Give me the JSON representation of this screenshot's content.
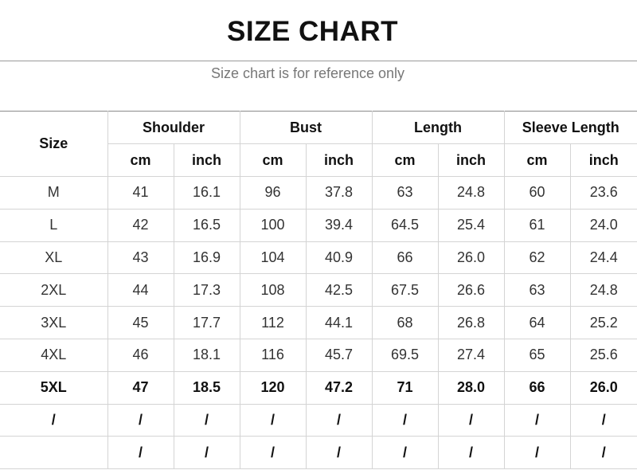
{
  "title": "SIZE CHART",
  "subtitle": "Size chart is for reference only",
  "headers": {
    "size": "Size",
    "shoulder": "Shoulder",
    "bust": "Bust",
    "length": "Length",
    "sleeve_length": "Sleeve Length",
    "cm": "cm",
    "inch": "inch"
  },
  "rows": [
    {
      "size": "M",
      "values": [
        "41",
        "16.1",
        "96",
        "37.8",
        "63",
        "24.8",
        "60",
        "23.6"
      ],
      "bold": false
    },
    {
      "size": "L",
      "values": [
        "42",
        "16.5",
        "100",
        "39.4",
        "64.5",
        "25.4",
        "61",
        "24.0"
      ],
      "bold": false
    },
    {
      "size": "XL",
      "values": [
        "43",
        "16.9",
        "104",
        "40.9",
        "66",
        "26.0",
        "62",
        "24.4"
      ],
      "bold": false
    },
    {
      "size": "2XL",
      "values": [
        "44",
        "17.3",
        "108",
        "42.5",
        "67.5",
        "26.6",
        "63",
        "24.8"
      ],
      "bold": false
    },
    {
      "size": "3XL",
      "values": [
        "45",
        "17.7",
        "112",
        "44.1",
        "68",
        "26.8",
        "64",
        "25.2"
      ],
      "bold": false
    },
    {
      "size": "4XL",
      "values": [
        "46",
        "18.1",
        "116",
        "45.7",
        "69.5",
        "27.4",
        "65",
        "25.6"
      ],
      "bold": false
    },
    {
      "size": "5XL",
      "values": [
        "47",
        "18.5",
        "120",
        "47.2",
        "71",
        "28.0",
        "66",
        "26.0"
      ],
      "bold": true
    },
    {
      "size": "/",
      "values": [
        "/",
        "/",
        "/",
        "/",
        "/",
        "/",
        "/",
        "/"
      ],
      "bold": true
    },
    {
      "size": "",
      "values": [
        "/",
        "/",
        "/",
        "/",
        "/",
        "/",
        "/",
        "/"
      ],
      "bold": true
    }
  ]
}
